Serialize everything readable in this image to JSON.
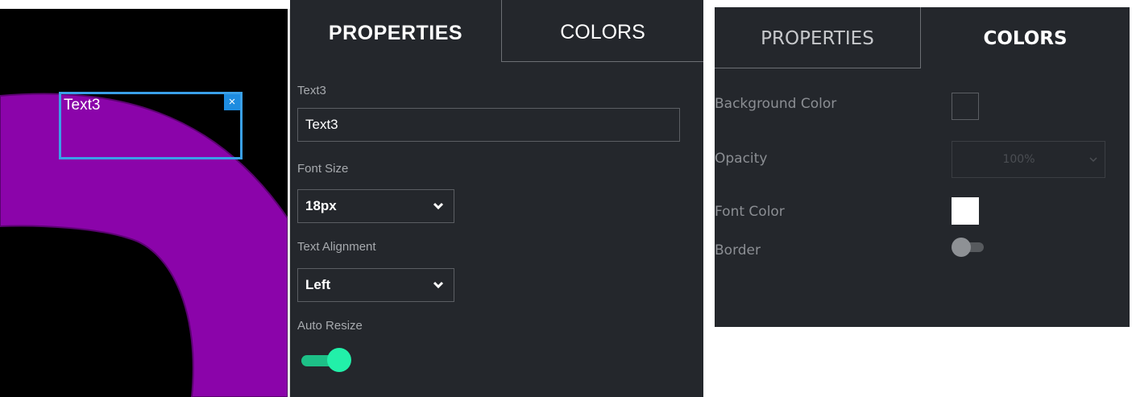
{
  "canvas": {
    "text_box_label": "Text3",
    "close_glyph": "×",
    "colors": {
      "background": "#000000",
      "shape": "#8b04aa",
      "selection": "#3aa0e8"
    }
  },
  "properties_panel": {
    "tabs": [
      {
        "label": "PROPERTIES",
        "active": true
      },
      {
        "label": "COLORS",
        "active": false
      }
    ],
    "text_field": {
      "label": "Text3",
      "value": "Text3"
    },
    "font_size": {
      "label": "Font Size",
      "value": "18px"
    },
    "text_alignment": {
      "label": "Text Alignment",
      "value": "Left"
    },
    "auto_resize": {
      "label": "Auto Resize",
      "on": true
    },
    "caret_glyph": "❯",
    "colors": {
      "toggle_on": "#22f0a9",
      "panel_bg": "#24272c"
    }
  },
  "colors_panel": {
    "tabs": [
      {
        "label": "PROPERTIES",
        "active": false
      },
      {
        "label": "COLORS",
        "active": true
      }
    ],
    "background_color": {
      "label": "Background Color"
    },
    "opacity": {
      "label": "Opacity",
      "value": "100%"
    },
    "font_color": {
      "label": "Font Color",
      "value": "#ffffff"
    },
    "border": {
      "label": "Border",
      "on": false
    },
    "caret_glyph": "⌄"
  }
}
